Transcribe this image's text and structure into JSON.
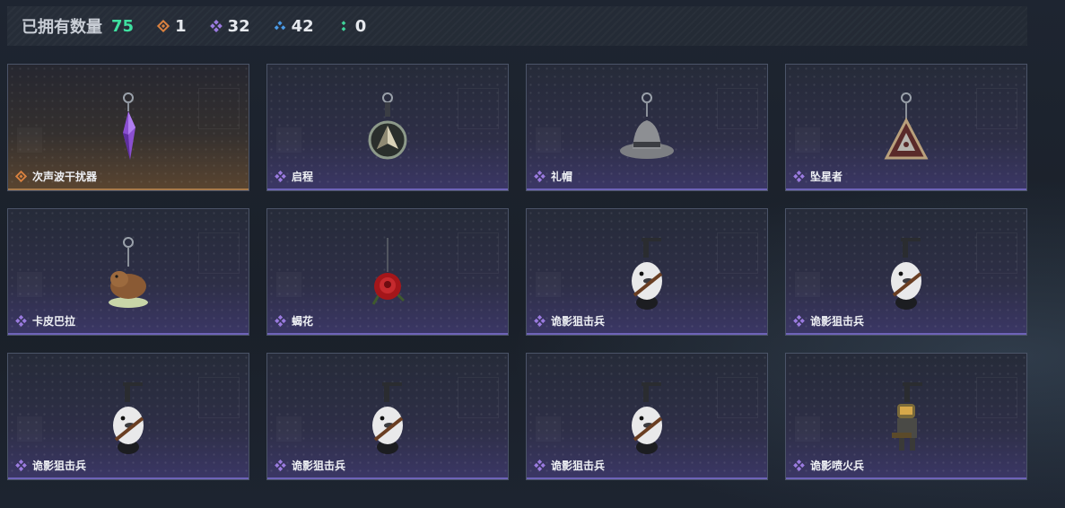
{
  "header": {
    "owned_label": "已拥有数量",
    "owned_total": "75",
    "stats": [
      {
        "icon": "orange-rarity-icon",
        "color": "#d9813f",
        "value": "1"
      },
      {
        "icon": "purple-rarity-icon",
        "color": "#9b7be0",
        "value": "32"
      },
      {
        "icon": "blue-rarity-icon",
        "color": "#4a9be8",
        "value": "42"
      },
      {
        "icon": "green-rarity-icon",
        "color": "#3fd49a",
        "value": "0"
      }
    ]
  },
  "items": [
    {
      "name": "次声波干扰器",
      "rarity": "orange",
      "art": "purple-crystal-pendant"
    },
    {
      "name": "启程",
      "rarity": "purple",
      "art": "compass-medal-pendant"
    },
    {
      "name": "礼帽",
      "rarity": "purple",
      "art": "fedora-hat-pendant"
    },
    {
      "name": "坠星者",
      "rarity": "purple",
      "art": "triangle-badge-pendant"
    },
    {
      "name": "卡皮巴拉",
      "rarity": "purple",
      "art": "capybara-pendant"
    },
    {
      "name": "蝎花",
      "rarity": "purple",
      "art": "red-rose-pendant"
    },
    {
      "name": "诡影狙击兵",
      "rarity": "purple",
      "art": "sniper-duck-pendant"
    },
    {
      "name": "诡影狙击兵",
      "rarity": "purple",
      "art": "sniper-duck-pendant"
    },
    {
      "name": "诡影狙击兵",
      "rarity": "purple",
      "art": "sniper-duck-pendant"
    },
    {
      "name": "诡影狙击兵",
      "rarity": "purple",
      "art": "sniper-duck-pendant"
    },
    {
      "name": "诡影狙击兵",
      "rarity": "purple",
      "art": "sniper-duck-pendant"
    },
    {
      "name": "诡影喷火兵",
      "rarity": "purple",
      "art": "flamethrower-soldier-pendant"
    }
  ]
}
